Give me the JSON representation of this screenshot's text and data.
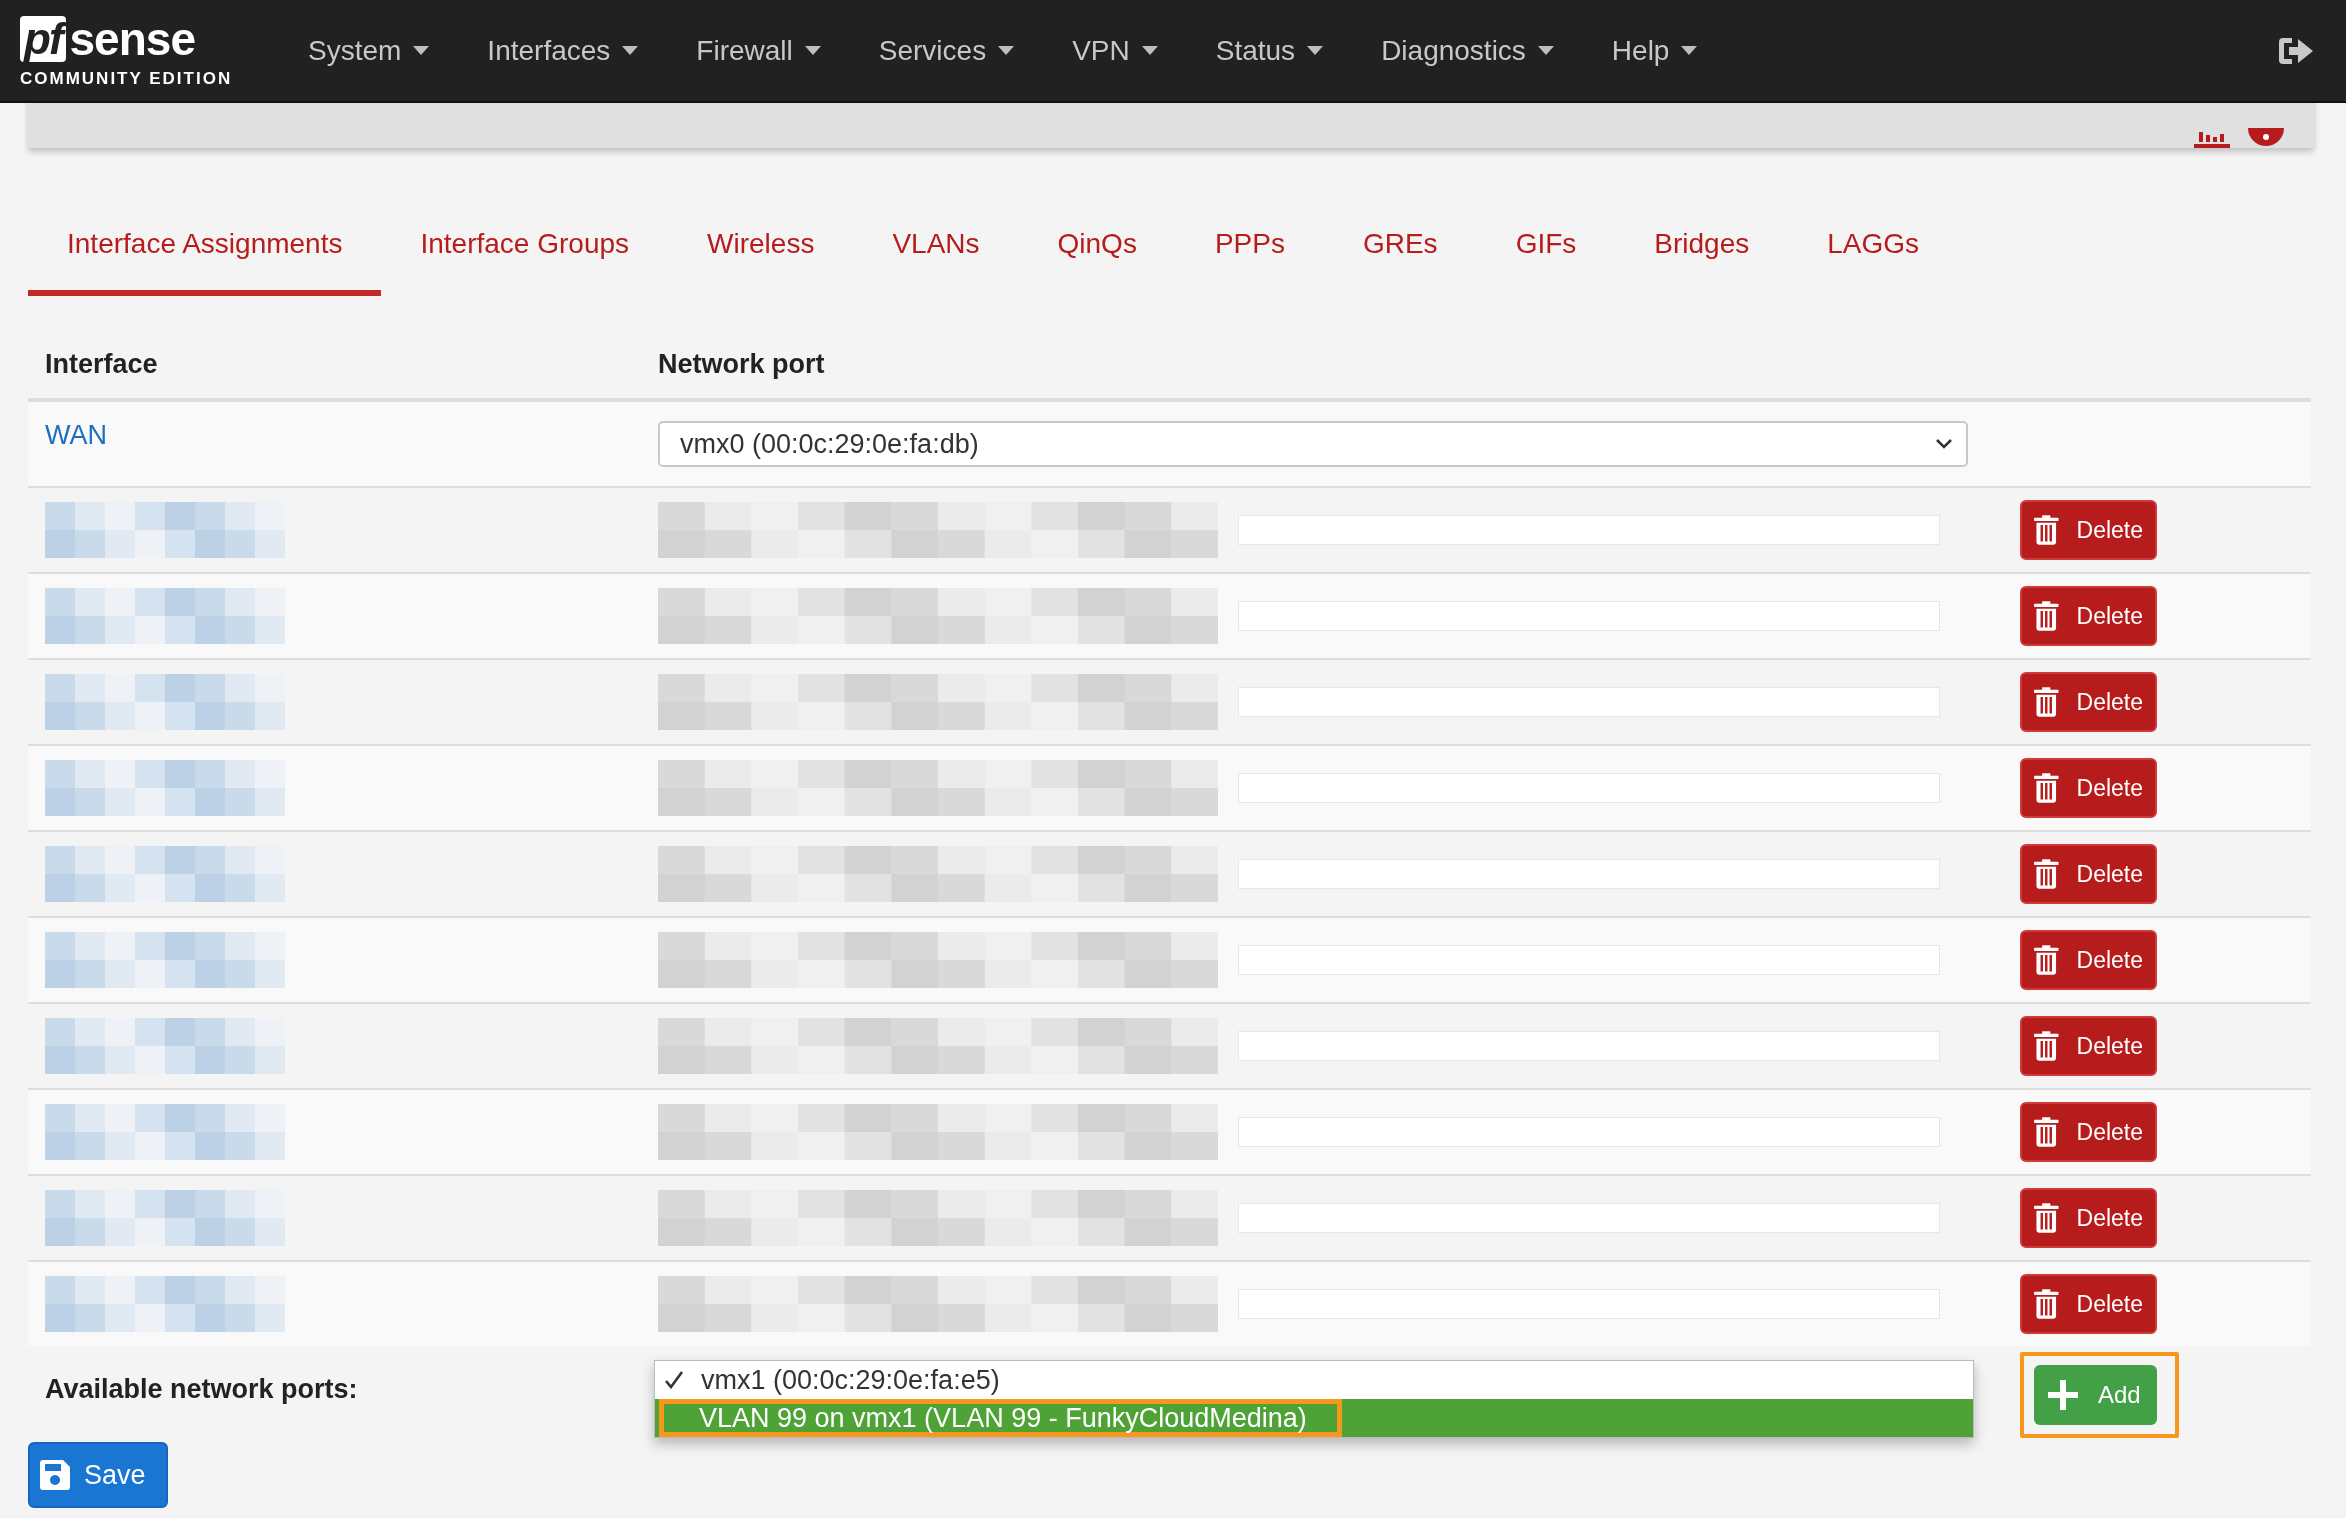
{
  "navbar": {
    "logo": {
      "brand": "sense",
      "brand_mark": "pf",
      "edition": "COMMUNITY EDITION"
    },
    "menu": [
      {
        "label": "System"
      },
      {
        "label": "Interfaces"
      },
      {
        "label": "Firewall"
      },
      {
        "label": "Services"
      },
      {
        "label": "VPN"
      },
      {
        "label": "Status"
      },
      {
        "label": "Diagnostics"
      },
      {
        "label": "Help"
      }
    ]
  },
  "tabs": [
    {
      "label": "Interface Assignments",
      "selected": true
    },
    {
      "label": "Interface Groups",
      "selected": false
    },
    {
      "label": "Wireless",
      "selected": false
    },
    {
      "label": "VLANs",
      "selected": false
    },
    {
      "label": "QinQs",
      "selected": false
    },
    {
      "label": "PPPs",
      "selected": false
    },
    {
      "label": "GREs",
      "selected": false
    },
    {
      "label": "GIFs",
      "selected": false
    },
    {
      "label": "Bridges",
      "selected": false
    },
    {
      "label": "LAGGs",
      "selected": false
    }
  ],
  "table": {
    "columns": [
      "Interface",
      "Network port"
    ],
    "rows": [
      {
        "kind": "plain",
        "interface": "WAN",
        "port": "vmx0 (00:0c:29:0e:fa:db)"
      },
      {
        "kind": "redacted",
        "delete": "Delete"
      },
      {
        "kind": "redacted",
        "delete": "Delete"
      },
      {
        "kind": "redacted",
        "delete": "Delete"
      },
      {
        "kind": "redacted",
        "delete": "Delete"
      },
      {
        "kind": "redacted",
        "delete": "Delete"
      },
      {
        "kind": "redacted",
        "delete": "Delete"
      },
      {
        "kind": "redacted",
        "delete": "Delete"
      },
      {
        "kind": "redacted",
        "delete": "Delete"
      },
      {
        "kind": "redacted",
        "delete": "Delete"
      },
      {
        "kind": "redacted",
        "delete": "Delete"
      }
    ]
  },
  "available": {
    "label": "Available network ports:",
    "options": [
      {
        "label": "vmx1 (00:0c:29:0e:fa:e5)",
        "selected": true,
        "highlighted": false,
        "annotated": false
      },
      {
        "label": "VLAN 99 on vmx1 (VLAN 99 - FunkyCloudMedina)",
        "selected": false,
        "highlighted": true,
        "annotated": true
      }
    ],
    "add_button": {
      "label": "Add",
      "annotated": true
    }
  },
  "save_button": {
    "label": "Save"
  }
}
